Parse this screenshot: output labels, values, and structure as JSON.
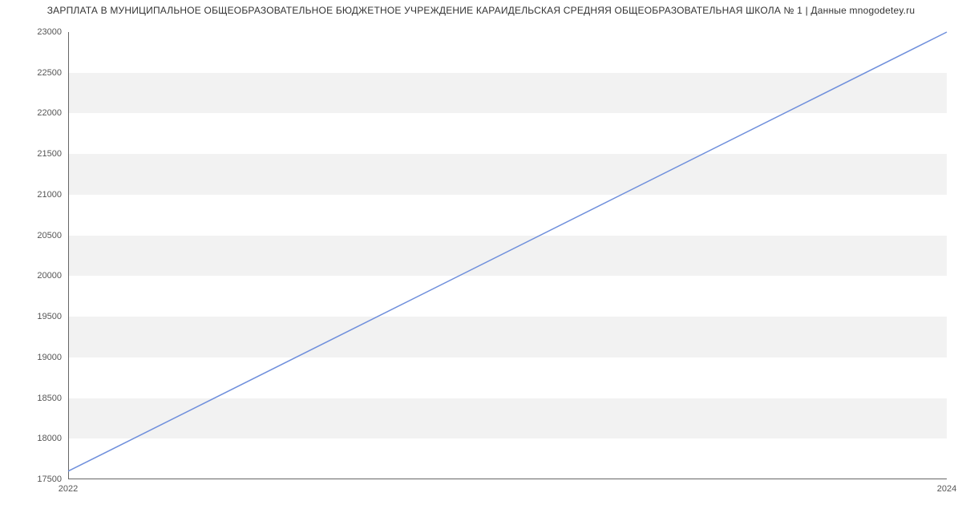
{
  "title": "ЗАРПЛАТА В МУНИЦИПАЛЬНОЕ ОБЩЕОБРАЗОВАТЕЛЬНОЕ БЮДЖЕТНОЕ УЧРЕЖДЕНИЕ           КАРАИДЕЛЬСКАЯ СРЕДНЯЯ ОБЩЕОБРАЗОВАТЕЛЬНАЯ ШКОЛА № 1 | Данные mnogodetey.ru",
  "chart_data": {
    "type": "line",
    "x": [
      2022,
      2024
    ],
    "y": [
      17600,
      23000
    ],
    "title": "ЗАРПЛАТА В МУНИЦИПАЛЬНОЕ ОБЩЕОБРАЗОВАТЕЛЬНОЕ БЮДЖЕТНОЕ УЧРЕЖДЕНИЕ КАРАИДЕЛЬСКАЯ СРЕДНЯЯ ОБЩЕОБРАЗОВАТЕЛЬНАЯ ШКОЛА № 1 | Данные mnogodetey.ru",
    "xlabel": "",
    "ylabel": "",
    "xlim": [
      2022,
      2024
    ],
    "ylim": [
      17500,
      23000
    ],
    "x_ticks": [
      2022,
      2024
    ],
    "y_ticks": [
      17500,
      18000,
      18500,
      19000,
      19500,
      20000,
      20500,
      21000,
      21500,
      22000,
      22500,
      23000
    ],
    "series": [
      {
        "name": "Зарплата",
        "x": [
          2022,
          2024
        ],
        "y": [
          17600,
          23000
        ]
      }
    ]
  }
}
